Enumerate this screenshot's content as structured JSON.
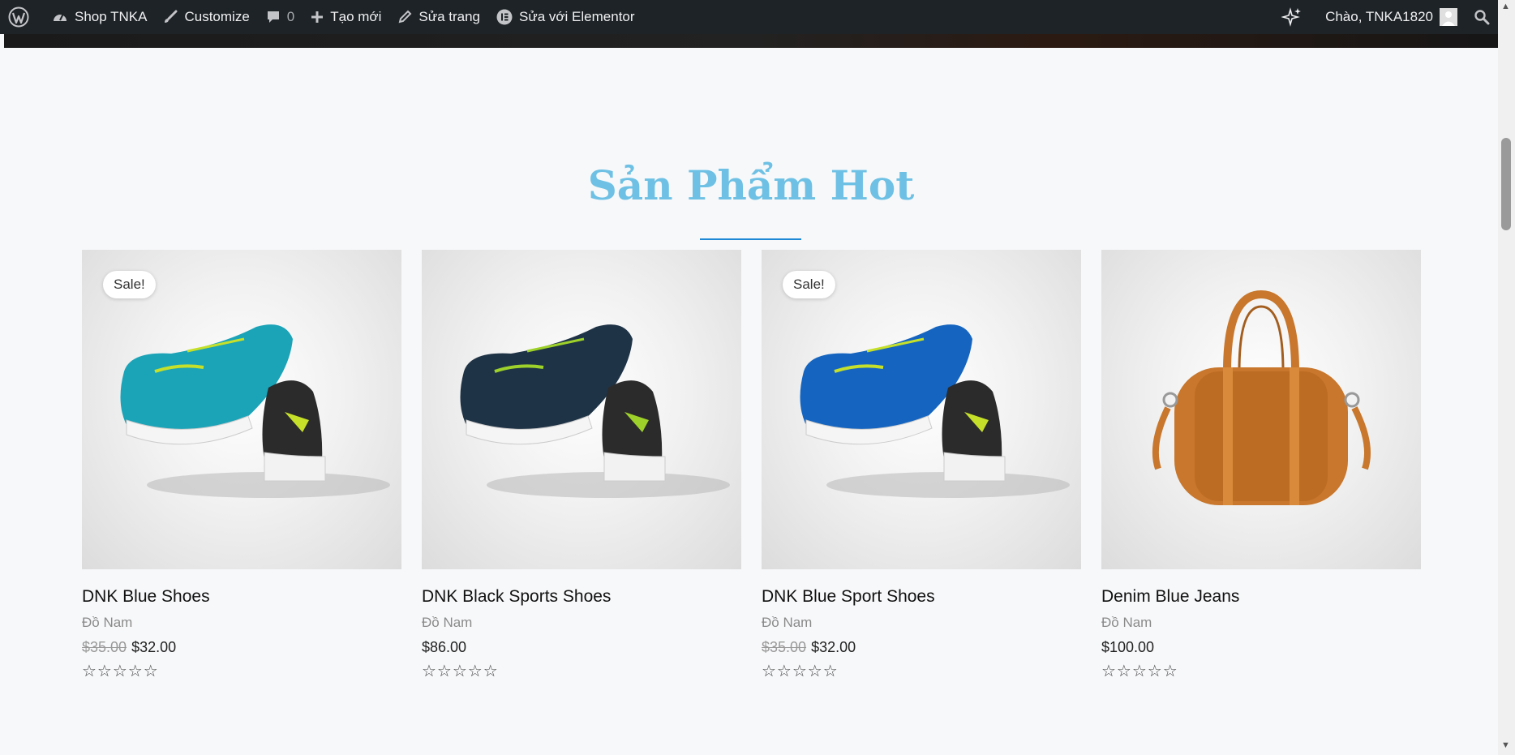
{
  "adminbar": {
    "site_name": "Shop TNKA",
    "customize": "Customize",
    "comments_count": "0",
    "new_label": "Tạo mới",
    "edit_page": "Sửa trang",
    "edit_elementor": "Sửa với Elementor",
    "greeting": "Chào, TNKA1820"
  },
  "section": {
    "title": "Sản Phẩm Hot"
  },
  "products": [
    {
      "badge": "Sale!",
      "name": "DNK Blue Shoes",
      "category": "Đồ Nam",
      "old_price": "$35.00",
      "price": "$32.00",
      "rating": "☆☆☆☆☆",
      "shoe_color": "#1ba3b8"
    },
    {
      "badge": "",
      "name": "DNK Black Sports Shoes",
      "category": "Đồ Nam",
      "old_price": "",
      "price": "$86.00",
      "rating": "☆☆☆☆☆",
      "shoe_color": "#1f3346"
    },
    {
      "badge": "Sale!",
      "name": "DNK Blue Sport Shoes",
      "category": "Đồ Nam",
      "old_price": "$35.00",
      "price": "$32.00",
      "rating": "☆☆☆☆☆",
      "shoe_color": "#1565c0"
    },
    {
      "badge": "",
      "name": "Denim Blue Jeans",
      "category": "Đồ Nam",
      "old_price": "",
      "price": "$100.00",
      "rating": "☆☆☆☆☆",
      "bag_color": "#c8772c"
    }
  ],
  "colors": {
    "title": "#6ec1e4",
    "divider": "#1e88d6",
    "adminbar": "#1d2327"
  }
}
